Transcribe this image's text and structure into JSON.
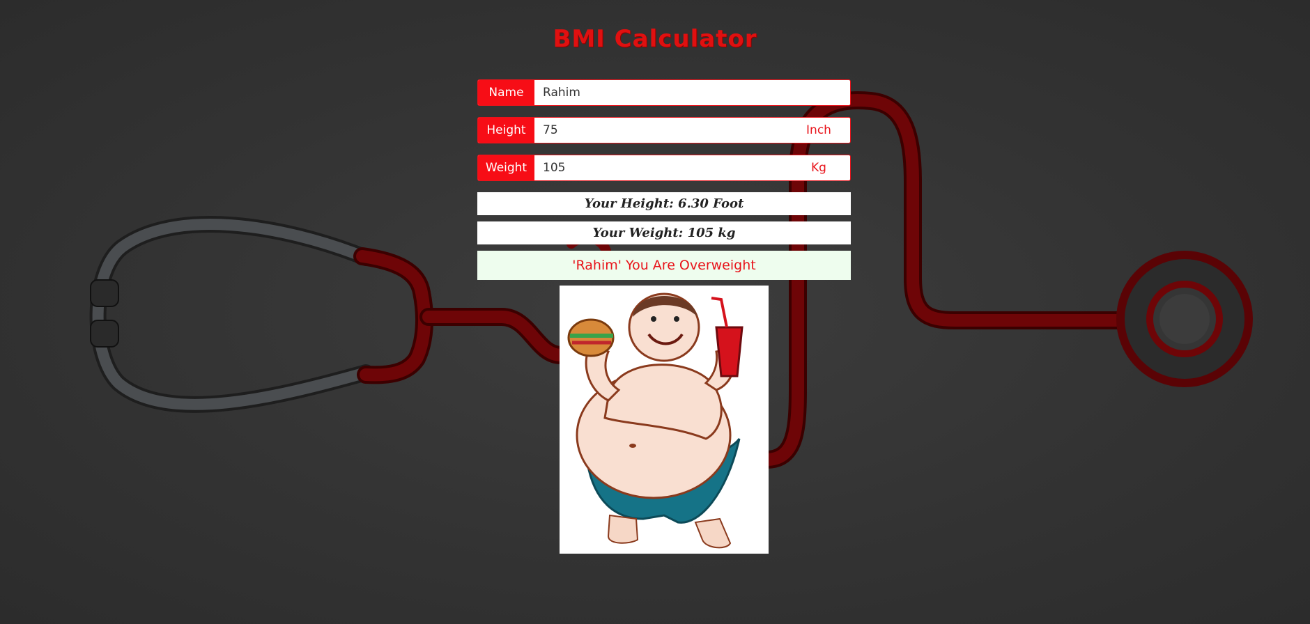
{
  "header": {
    "title": "BMI Calculator"
  },
  "form": {
    "name": {
      "label": "Name",
      "value": "Rahim"
    },
    "height": {
      "label": "Height",
      "value": "75",
      "unit": "Inch"
    },
    "weight": {
      "label": "Weight",
      "value": "105",
      "unit": "Kg"
    }
  },
  "results": {
    "height_text": "Your Height: 6.30 Foot",
    "weight_text": "Your Weight: 105 kg",
    "verdict": "'Rahim' You Are Overweight"
  },
  "colors": {
    "accent": "#f70d16",
    "title": "#e01010",
    "result_bg": "#eefdee",
    "page_bg": "#333333"
  },
  "illustration": {
    "icon": "overweight-man-with-burger-and-soda-icon"
  }
}
